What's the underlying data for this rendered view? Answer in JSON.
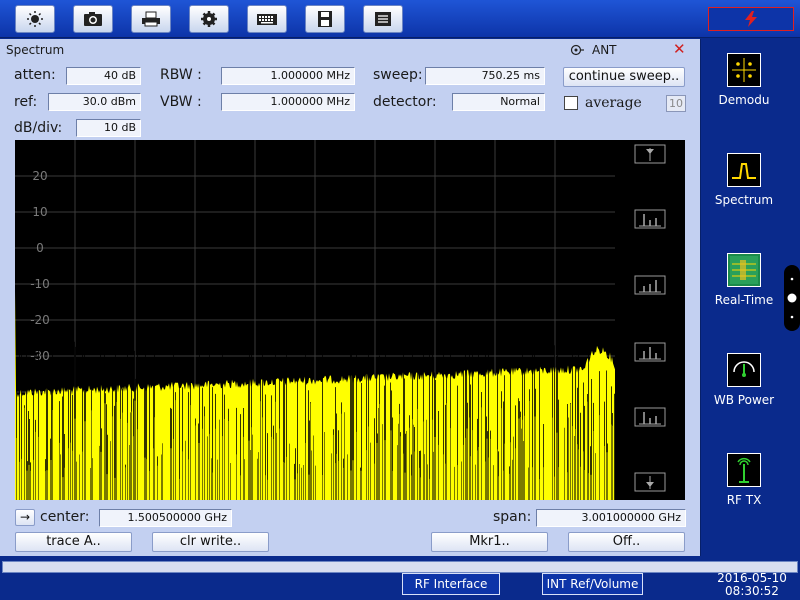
{
  "toolbar": {
    "icons": [
      "brightness-icon",
      "camera-icon",
      "printer-icon",
      "settings-icon",
      "keyboard-icon",
      "save-icon",
      "document-icon"
    ]
  },
  "panel": {
    "title": "Spectrum",
    "input_label": "ANT",
    "atten_label": "atten:",
    "atten_value": "40 dB",
    "ref_label": "ref:",
    "ref_value": "30.0 dBm",
    "dbdiv_label": "dB/div:",
    "dbdiv_value": "10 dB",
    "rbw_label": "RBW :",
    "rbw_value": "1.000000 MHz",
    "vbw_label": "VBW :",
    "vbw_value": "1.000000 MHz",
    "sweep_label": "sweep:",
    "sweep_value": "750.25 ms",
    "detector_label": "detector:",
    "detector_value": "Normal",
    "continue_sweep_label": "continue sweep..",
    "average_label": "average",
    "average_count": "10",
    "center_label": "center:",
    "center_value": "1.500500000 GHz",
    "span_label": "span:",
    "span_value": "3.001000000 GHz",
    "trace_button": "trace A..",
    "clr_write_button": "clr write..",
    "marker_button": "Mkr1..",
    "off_button": "Off.."
  },
  "chart_data": {
    "type": "line",
    "y_ticks": [
      "20",
      "10",
      "0",
      "-10",
      "-20",
      "-30"
    ],
    "y_tick_values": [
      20,
      10,
      0,
      -10,
      -20,
      -30
    ],
    "ylim": [
      -70,
      30
    ],
    "grid": true,
    "trace_color": "#ffff00",
    "noise_floor_start_dbm": -39,
    "noise_floor_end_dbm": -32,
    "peak_dbm": -27
  },
  "sidebar": {
    "items": [
      {
        "label": "Demodu",
        "icon": "demodulation-icon"
      },
      {
        "label": "Spectrum",
        "icon": "spectrum-icon"
      },
      {
        "label": "Real-Time",
        "icon": "real-time-icon"
      },
      {
        "label": "WB Power",
        "icon": "wideband-power-icon"
      },
      {
        "label": "RF TX",
        "icon": "rf-tx-icon"
      }
    ]
  },
  "bottom": {
    "rf_interface": "RF Interface",
    "ref_volume": "INT Ref/Volume",
    "date": "2016-05-10",
    "time": "08:30:52"
  },
  "colors": {
    "panel_bg": "#c3d0f1",
    "frame_bg": "#0a2a8c",
    "trace": "#ffff00"
  }
}
